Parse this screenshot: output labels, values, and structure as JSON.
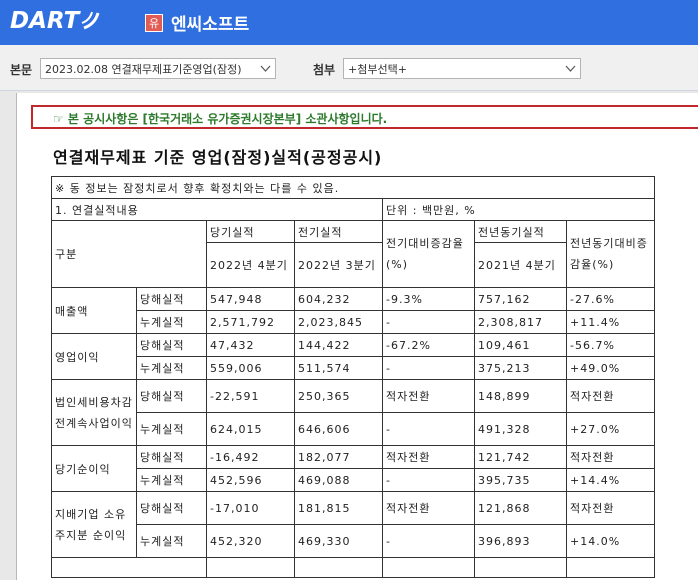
{
  "header": {
    "logo_text": "DART",
    "market_badge": "유",
    "company_name": "엔씨소프트"
  },
  "selectors": {
    "main_label": "본문",
    "main_value": "2023.02.08  연결재무제표기준영업(잠정)",
    "attach_label": "첨부",
    "attach_value": "+첨부선택+"
  },
  "notice": "☞ 본 공시사항은 [한국거래소 유가증권시장본부] 소관사항입니다.",
  "title": "연결재무제표 기준 영업(잠정)실적(공정공시)",
  "table": {
    "note": "※ 동 정보는 잠정치로서 향후 확정치와는 다를 수 있음.",
    "section": "1. 연결실적내용",
    "unit": "단위 : 백만원, %",
    "headers": {
      "category": "구분",
      "current": "당기실적",
      "current_period": "2022년 4분기",
      "previous": "전기실적",
      "previous_period": "2022년 3분기",
      "prev_change": "전기대비증감율(%)",
      "last_year": "전년동기실적",
      "last_year_period": "2021년 4분기",
      "ly_change": "전년동기대비증감율(%)"
    },
    "groups": [
      {
        "name": "매출액",
        "rows": [
          {
            "type": "당해실적",
            "current": "547,948",
            "previous": "604,232",
            "prev_rate": "-9.3%",
            "last_year": "757,162",
            "ly_rate": "-27.6%"
          },
          {
            "type": "누계실적",
            "current": "2,571,792",
            "previous": "2,023,845",
            "prev_rate": "-",
            "last_year": "2,308,817",
            "ly_rate": "+11.4%"
          }
        ]
      },
      {
        "name": "영업이익",
        "rows": [
          {
            "type": "당해실적",
            "current": "47,432",
            "previous": "144,422",
            "prev_rate": "-67.2%",
            "last_year": "109,461",
            "ly_rate": "-56.7%"
          },
          {
            "type": "누계실적",
            "current": "559,006",
            "previous": "511,574",
            "prev_rate": "-",
            "last_year": "375,213",
            "ly_rate": "+49.0%"
          }
        ]
      },
      {
        "name": "법인세비용차감전계속사업이익",
        "rows": [
          {
            "type": "당해실적",
            "current": "-22,591",
            "previous": "250,365",
            "prev_rate": "적자전환",
            "last_year": "148,899",
            "ly_rate": "적자전환"
          },
          {
            "type": "누계실적",
            "current": "624,015",
            "previous": "646,606",
            "prev_rate": "-",
            "last_year": "491,328",
            "ly_rate": "+27.0%"
          }
        ]
      },
      {
        "name": "당기순이익",
        "rows": [
          {
            "type": "당해실적",
            "current": "-16,492",
            "previous": "182,077",
            "prev_rate": "적자전환",
            "last_year": "121,742",
            "ly_rate": "적자전환"
          },
          {
            "type": "누계실적",
            "current": "452,596",
            "previous": "469,088",
            "prev_rate": "-",
            "last_year": "395,735",
            "ly_rate": "+14.4%"
          }
        ]
      },
      {
        "name": "지배기업 소유주지분 순이익",
        "rows": [
          {
            "type": "당해실적",
            "current": "-17,010",
            "previous": "181,815",
            "prev_rate": "적자전환",
            "last_year": "121,868",
            "ly_rate": "적자전환"
          },
          {
            "type": "누계실적",
            "current": "452,320",
            "previous": "469,330",
            "prev_rate": "-",
            "last_year": "396,893",
            "ly_rate": "+14.0%"
          }
        ]
      }
    ]
  },
  "colors": {
    "header_blue": "#2f6fe0",
    "notice_border": "#c0282d",
    "notice_text": "#2c7a2c",
    "badge_red": "#e25b55"
  }
}
